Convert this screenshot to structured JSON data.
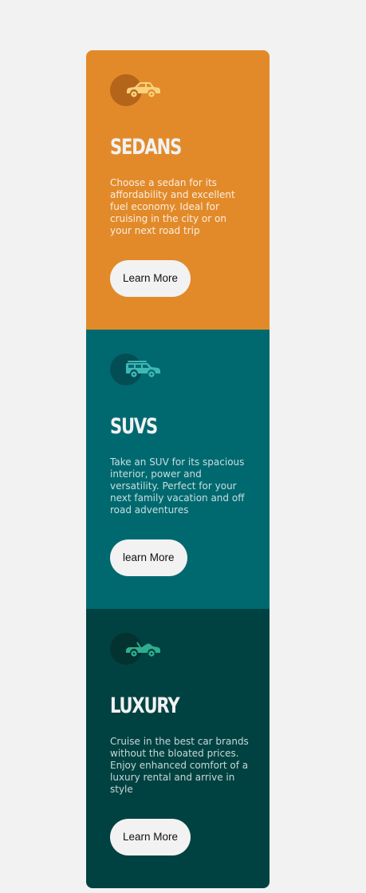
{
  "cards": [
    {
      "id": "sedans",
      "title": "SEDANS",
      "description": "Choose a sedan for its affordability and excellent fuel economy. Ideal for cruising in the city or on your next road trip",
      "button_label": "Learn More",
      "icon": "sedan-car-icon",
      "background": "#e28a2a",
      "icon_color": "#f9d27e",
      "circle_color": "#b4651a"
    },
    {
      "id": "suvs",
      "title": "SUVS",
      "description": "Take an SUV for its spacious interior, power and versatility. Perfect for your next family vacation and off road adventures",
      "button_label": "learn More",
      "icon": "suv-car-icon",
      "background": "#006970",
      "icon_color": "#3fb8b5",
      "circle_color": "#034e54"
    },
    {
      "id": "luxury",
      "title": "LUXURY",
      "description": "Cruise in the best car brands without the bloated prices. Enjoy enhanced comfort of a luxury rental and arrive in style",
      "button_label": "Learn More",
      "icon": "convertible-car-icon",
      "background": "#004241",
      "icon_color": "#2fae8e",
      "circle_color": "#033230"
    }
  ]
}
